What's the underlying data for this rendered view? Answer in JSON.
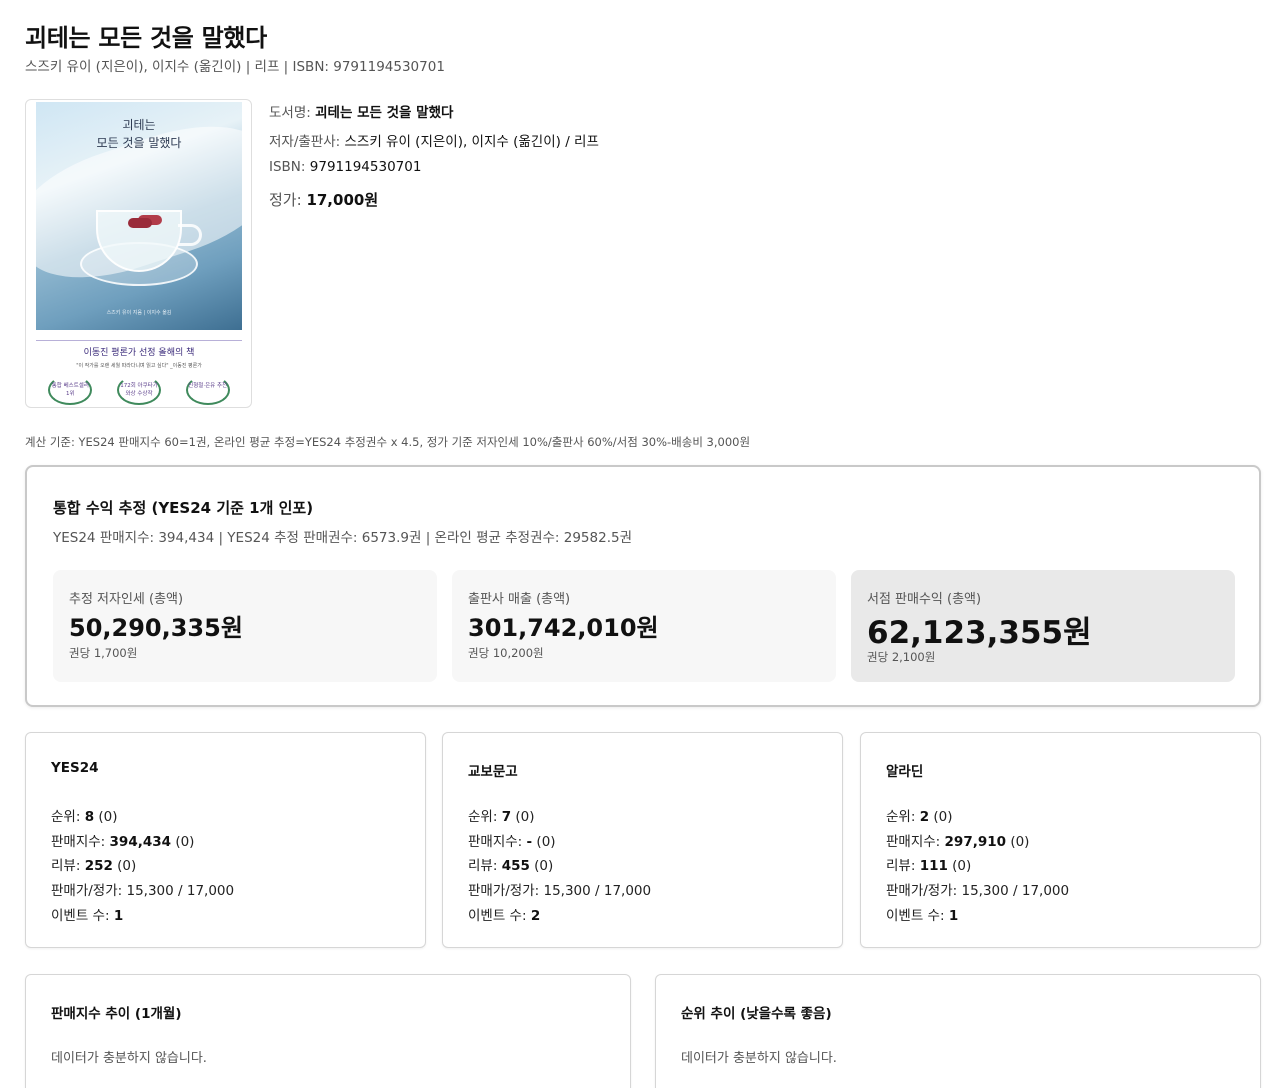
{
  "header": {
    "title": "괴테는 모든 것을 말했다",
    "subtitle": "스즈키 유이 (지은이), 이지수 (옮긴이) | 리프 | ISBN: 9791194530701"
  },
  "cover": {
    "title_line1": "괴테는",
    "title_line2": "모든 것을 말했다",
    "credit": "스즈키 유이 지음 | 이지수 옮김",
    "tagline": "이동진 평론가 선정 올해의 책",
    "quote": "\"이 작가를 오랜 세월 따라다니며 읽고 싶다\" _이동진 평론가",
    "badges": [
      "통합 베스트셀러 1위",
      "172회 아쿠타가와상 수상작",
      "신형철·은유 추천"
    ]
  },
  "details": {
    "title_label": "도서명: ",
    "title_value": "괴테는 모든 것을 말했다",
    "author_label": "저자/출판사: ",
    "author_value": "스즈키 유이 (지은이), 이지수 (옮긴이) / 리프",
    "isbn_label": "ISBN: ",
    "isbn_value": "9791194530701",
    "price_label": "정가: ",
    "price_value": "17,000원"
  },
  "calc_basis": "계산 기준: YES24 판매지수 60=1권, 온라인 평균 추정=YES24 추정권수 x 4.5, 정가 기준 저자인세 10%/출판사 60%/서점 30%-배송비 3,000원",
  "summary": {
    "title": "통합 수익 추정 (YES24 기준 1개 인포)",
    "sub": "YES24 판매지수: 394,434 | YES24 추정 판매권수: 6573.9권 | 온라인 평균 추정권수: 29582.5권",
    "metrics": [
      {
        "label": "추정 저자인세 (총액)",
        "value": "50,290,335원",
        "unit": "권당 1,700원"
      },
      {
        "label": "출판사 매출 (총액)",
        "value": "301,742,010원",
        "unit": "권당 10,200원"
      },
      {
        "label": "서점 판매수익 (총액)",
        "value": "62,123,355원",
        "unit": "권당 2,100원"
      }
    ]
  },
  "stores": [
    {
      "name": "YES24",
      "rank_label": "순위: ",
      "rank": "8",
      "rank_delta": " (0)",
      "index_label": "판매지수: ",
      "index": "394,434",
      "index_delta": " (0)",
      "review_label": "리뷰: ",
      "review": "252",
      "review_delta": " (0)",
      "price_line": "판매가/정가: 15,300 / 17,000",
      "event_label": "이벤트 수: ",
      "event": "1"
    },
    {
      "name": "교보문고",
      "rank_label": "순위: ",
      "rank": "7",
      "rank_delta": " (0)",
      "index_label": "판매지수: ",
      "index": "-",
      "index_delta": " (0)",
      "review_label": "리뷰: ",
      "review": "455",
      "review_delta": " (0)",
      "price_line": "판매가/정가: 15,300 / 17,000",
      "event_label": "이벤트 수: ",
      "event": "2"
    },
    {
      "name": "알라딘",
      "rank_label": "순위: ",
      "rank": "2",
      "rank_delta": " (0)",
      "index_label": "판매지수: ",
      "index": "297,910",
      "index_delta": " (0)",
      "review_label": "리뷰: ",
      "review": "111",
      "review_delta": " (0)",
      "price_line": "판매가/정가: 15,300 / 17,000",
      "event_label": "이벤트 수: ",
      "event": "1"
    }
  ],
  "trends": [
    {
      "title": "판매지수 추이 (1개월)",
      "empty": "데이터가 충분하지 않습니다."
    },
    {
      "title": "순위 추이 (낮을수록 좋음)",
      "empty": "데이터가 충분하지 않습니다."
    }
  ]
}
